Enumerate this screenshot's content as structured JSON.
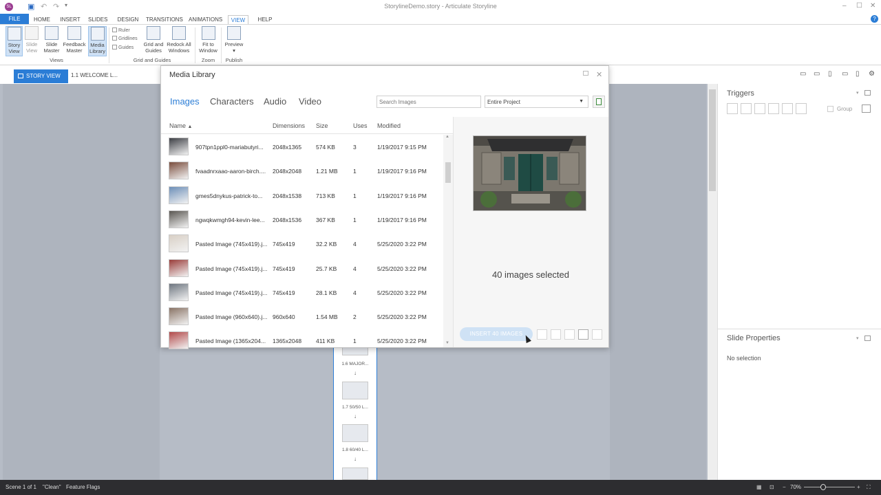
{
  "window": {
    "title": "StorylineDemo.story - Articulate Storyline",
    "app_icon": "SL",
    "controls": [
      "–",
      "☐",
      "✕"
    ]
  },
  "quick_access": [
    "save-icon",
    "undo-icon",
    "redo-icon",
    "customize-icon"
  ],
  "menu": {
    "tabs": [
      "FILE",
      "HOME",
      "INSERT",
      "SLIDES",
      "DESIGN",
      "TRANSITIONS",
      "ANIMATIONS",
      "VIEW",
      "HELP"
    ],
    "active": "VIEW"
  },
  "ribbon": {
    "views": [
      {
        "top": "Story",
        "bottom": "View",
        "selected": true
      },
      {
        "top": "Slide",
        "bottom": "View",
        "dim": true
      },
      {
        "top": "Slide",
        "bottom": "Master"
      },
      {
        "top": "Feedback",
        "bottom": "Master"
      },
      {
        "top": "Media",
        "bottom": "Library",
        "selected": true
      }
    ],
    "views_label": "Views",
    "checks": [
      "Ruler",
      "Gridlines",
      "Guides"
    ],
    "grid": [
      {
        "top": "Grid and",
        "bottom": "Guides"
      },
      {
        "top": "Redock All",
        "bottom": "Windows"
      }
    ],
    "grid_label": "Grid and Guides",
    "zoom": {
      "top": "Fit to",
      "bottom": "Window"
    },
    "zoom_label": "Zoom",
    "publish": {
      "top": "Preview",
      "bottom": "▾"
    },
    "publish_label": "Publish"
  },
  "tabs": {
    "story_view": "STORY VIEW",
    "slide": "1.1 WELCOME L..."
  },
  "triggers": {
    "title": "Triggers",
    "group_label": "Group"
  },
  "slide_properties": {
    "title": "Slide Properties",
    "empty": "No selection"
  },
  "story_strip": [
    {
      "label": "1.6 MAJOR..."
    },
    {
      "label": "1.7 50/50 L..."
    },
    {
      "label": "1.8 60/40 L..."
    }
  ],
  "status": {
    "scene": "Scene 1 of 1",
    "theme": "\"Clean\"",
    "flags": "Feature Flags",
    "zoom": "70%"
  },
  "media_library": {
    "title": "Media Library",
    "tabs": [
      "Images",
      "Characters",
      "Audio",
      "Video"
    ],
    "active_tab": "Images",
    "search_placeholder": "Search Images",
    "scope": "Entire Project",
    "columns": [
      "Name",
      "Dimensions",
      "Size",
      "Uses",
      "Modified"
    ],
    "rows": [
      {
        "name": "907tpn1ppl0-mariabutyri...",
        "dims": "2048x1365",
        "size": "574 KB",
        "uses": "3",
        "modified": "1/19/2017 9:15 PM",
        "thumb": "#3d3f45"
      },
      {
        "name": "fvaadnrxaao-aaron-birch....",
        "dims": "2048x2048",
        "size": "1.21 MB",
        "uses": "1",
        "modified": "1/19/2017 9:16 PM",
        "thumb": "#7a4d3d"
      },
      {
        "name": "gmes5dnykus-patrick-to...",
        "dims": "2048x1538",
        "size": "713 KB",
        "uses": "1",
        "modified": "1/19/2017 9:16 PM",
        "thumb": "#6d8fb8"
      },
      {
        "name": "ngwqkwmgh94-kevin-lee...",
        "dims": "2048x1536",
        "size": "367 KB",
        "uses": "1",
        "modified": "1/19/2017 9:16 PM",
        "thumb": "#5a5752"
      },
      {
        "name": "Pasted Image (745x419).j...",
        "dims": "745x419",
        "size": "32.2 KB",
        "uses": "4",
        "modified": "5/25/2020 3:22 PM",
        "thumb": "#d8cfc5"
      },
      {
        "name": "Pasted Image (745x419).j...",
        "dims": "745x419",
        "size": "25.7 KB",
        "uses": "4",
        "modified": "5/25/2020 3:22 PM",
        "thumb": "#9a3d3a"
      },
      {
        "name": "Pasted Image (745x419).j...",
        "dims": "745x419",
        "size": "28.1 KB",
        "uses": "4",
        "modified": "5/25/2020 3:22 PM",
        "thumb": "#6e7680"
      },
      {
        "name": "Pasted Image (960x640).j...",
        "dims": "960x640",
        "size": "1.54 MB",
        "uses": "2",
        "modified": "5/25/2020 3:22 PM",
        "thumb": "#8a7466"
      },
      {
        "name": "Pasted Image (1365x204...",
        "dims": "1365x2048",
        "size": "411 KB",
        "uses": "1",
        "modified": "5/25/2020 3:22 PM",
        "thumb": "#b24a4a"
      }
    ],
    "selected_count": "40 images selected",
    "insert_label": "INSERT 40 IMAGES"
  },
  "colors": {
    "accent": "#2b7dd6",
    "stage": "#b6bcc6",
    "status": "#2d2d30"
  }
}
